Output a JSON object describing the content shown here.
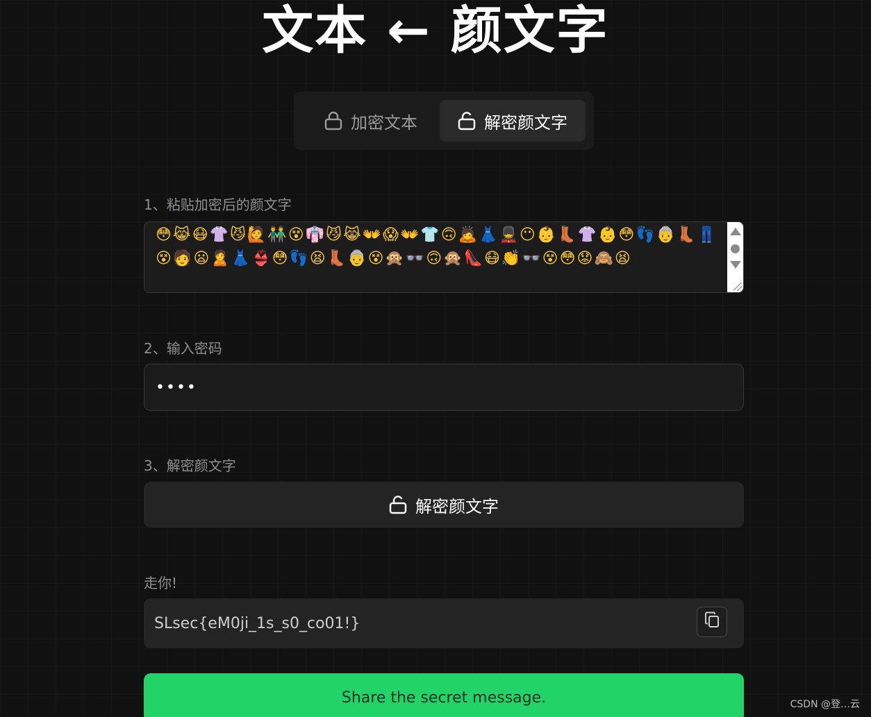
{
  "header": {
    "title": "文本 ← 颜文字"
  },
  "tabs": [
    {
      "label": "加密文本",
      "icon": "lock-icon",
      "active": false
    },
    {
      "label": "解密颜文字",
      "icon": "unlock-icon",
      "active": true
    }
  ],
  "step1": {
    "label": "1、粘贴加密后的颜文字",
    "value": "😳😹😷👚😼🙋👬😵👘😼😹👐😱👐👕🙃🙇👗💂😶👶👢👚👶😳👣👵👢👖😵🧑😦🙎👗👙😳👣😫👢👵😵🙊👓🙃🙊👠😷👏👓😵😳😟🙈😫"
  },
  "step2": {
    "label": "2、输入密码",
    "value": "••••"
  },
  "step3": {
    "label": "3、解密颜文字",
    "button_label": "解密颜文字",
    "icon": "unlock-icon"
  },
  "result": {
    "label": "走你!",
    "value": "SLsec{eM0ji_1s_s0_co01!}",
    "copy_icon": "copy-icon"
  },
  "share": {
    "label": "Share the secret message."
  },
  "watermark": "CSDN @登…云",
  "colors": {
    "accent": "#22d367",
    "background": "#111111",
    "panel": "#242424"
  }
}
